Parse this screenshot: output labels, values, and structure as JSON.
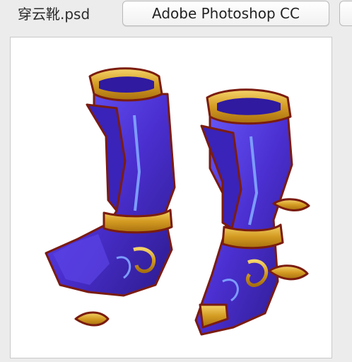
{
  "window": {
    "file_name": "穿云靴.psd",
    "app_button_label": "Adobe Photoshop CC"
  },
  "preview": {
    "subject": "boots-illustration"
  },
  "colors": {
    "boot_purple": "#4b2fd0",
    "boot_dark": "#2b1a8a",
    "trim_gold": "#d7a52b",
    "outline_red": "#7a1c10",
    "stripe_blue": "#7c9cff"
  }
}
